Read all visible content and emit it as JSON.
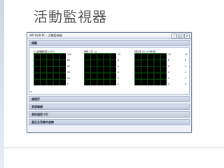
{
  "slide": {
    "title": "活動監視器"
  },
  "window": {
    "title": "ARTHUR-PC - 活動監視器",
    "buttons": [
      "‒",
      "□",
      "✕"
    ]
  },
  "sections": {
    "overview": "概觀",
    "collapsed": [
      "處理序",
      "資源聯網",
      "資料檔案 I/O",
      "最近且昂貴的查詢"
    ]
  },
  "charts": [
    {
      "label": "% 處理器時間 (CPU)",
      "ticks": [
        "100",
        "80",
        "60",
        "40",
        "20",
        "0"
      ]
    },
    {
      "label": "等候工作 (1)",
      "ticks": [
        "10",
        "8",
        "6",
        "4",
        "2",
        "0"
      ]
    },
    {
      "label": "資料庫 I/O (0 MB/秒)",
      "ticks": [
        "10",
        "8",
        "6",
        "4",
        "2",
        "0"
      ]
    },
    {
      "label": "",
      "ticks": [
        "10",
        "8",
        "6",
        "4",
        "2",
        "0"
      ]
    }
  ],
  "misc": {
    "scroll_arrow": "◂"
  }
}
